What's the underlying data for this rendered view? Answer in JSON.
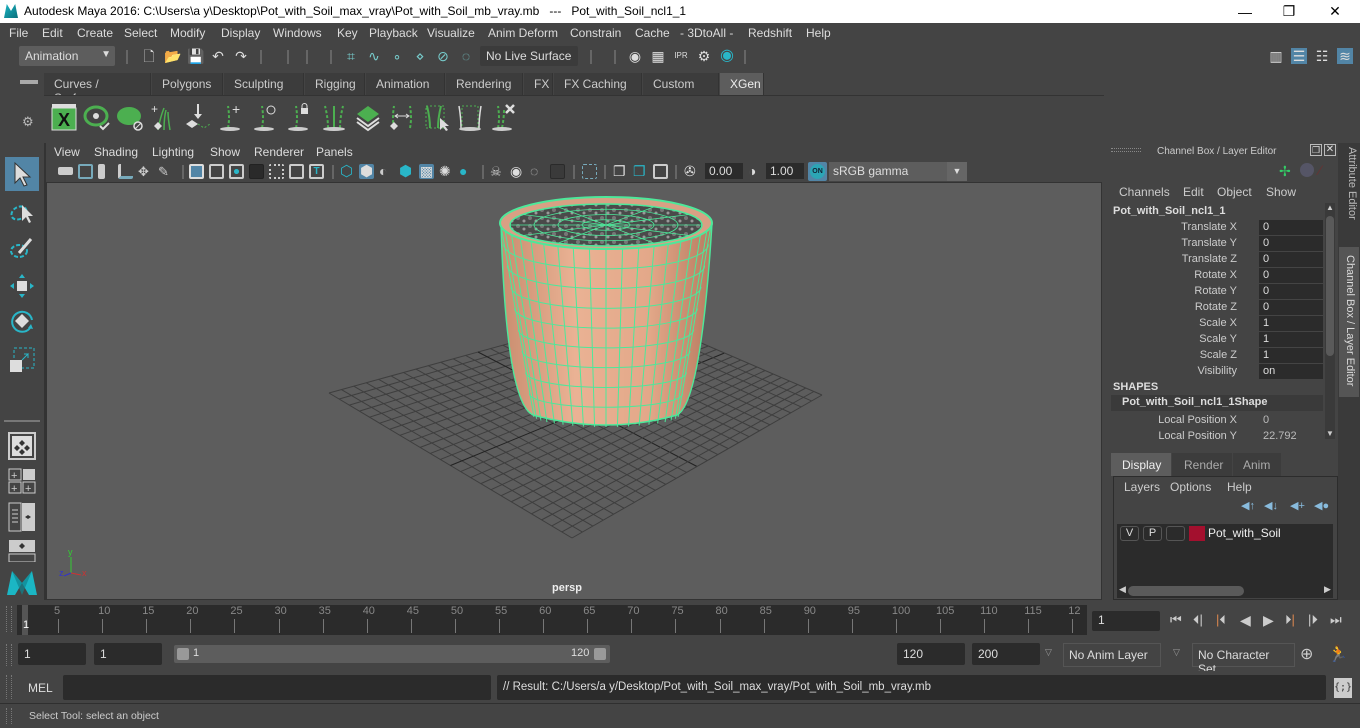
{
  "window": {
    "title": "Autodesk Maya 2016: C:\\Users\\a y\\Desktop\\Pot_with_Soil_max_vray\\Pot_with_Soil_mb_vray.mb   ---   Pot_with_Soil_ncl1_1",
    "minimize": "—",
    "maximize": "❐",
    "close": "✕"
  },
  "menubar": [
    "File",
    "Edit",
    "Create",
    "Select",
    "Modify",
    "Display",
    "Windows",
    "Key",
    "Playback",
    "Visualize",
    "Anim Deform",
    "Constrain",
    "Cache",
    "- 3DtoAll -",
    "Redshift",
    "Help"
  ],
  "toolbar": {
    "mode": "Animation",
    "live_surface": "No Live Surface"
  },
  "shelf": {
    "tabs": [
      "Curves / Surfaces",
      "Polygons",
      "Sculpting",
      "Rigging",
      "Animation",
      "Rendering",
      "FX",
      "FX Caching",
      "Custom",
      "XGen"
    ],
    "active_tab": "XGen",
    "icons": [
      "xgen-window-icon",
      "xgen-preview-icon",
      "xgen-clear-preview-icon",
      "xgen-add-guides-icon",
      "xgen-place-guides-icon",
      "xgen-add-guide-icon",
      "xgen-sculpt-guide-icon",
      "xgen-lock-guide-icon",
      "xgen-split-guide-icon",
      "xgen-tile-icon",
      "xgen-flip-guide-icon",
      "xgen-select-guide-icon",
      "xgen-guide-frame-icon",
      "xgen-delete-guide-icon"
    ]
  },
  "viewport": {
    "menu": [
      "View",
      "Shading",
      "Lighting",
      "Show",
      "Renderer",
      "Panels"
    ],
    "exposure": "0.00",
    "gamma": "1.00",
    "color_mgmt_toggle": "ON",
    "color_space": "sRGB gamma",
    "camera_label": "persp",
    "axis": {
      "x": "x",
      "y": "y",
      "z": "z"
    }
  },
  "channel_box": {
    "title": "Channel Box / Layer Editor",
    "menu": [
      "Channels",
      "Edit",
      "Object",
      "Show"
    ],
    "object_name": "Pot_with_Soil_ncl1_1",
    "attributes": [
      {
        "label": "Translate X",
        "value": "0"
      },
      {
        "label": "Translate Y",
        "value": "0"
      },
      {
        "label": "Translate Z",
        "value": "0"
      },
      {
        "label": "Rotate X",
        "value": "0"
      },
      {
        "label": "Rotate Y",
        "value": "0"
      },
      {
        "label": "Rotate Z",
        "value": "0"
      },
      {
        "label": "Scale X",
        "value": "1"
      },
      {
        "label": "Scale Y",
        "value": "1"
      },
      {
        "label": "Scale Z",
        "value": "1"
      },
      {
        "label": "Visibility",
        "value": "on"
      }
    ],
    "shapes_header": "SHAPES",
    "shape_name": "Pot_with_Soil_ncl1_1Shape",
    "shape_attributes": [
      {
        "label": "Local Position X",
        "value": "0"
      },
      {
        "label": "Local Position Y",
        "value": "22.792"
      }
    ]
  },
  "side_tabs": [
    "Attribute Editor",
    "Channel Box / Layer Editor"
  ],
  "layer_editor": {
    "tabs": [
      "Display",
      "Render",
      "Anim"
    ],
    "active_tab": "Display",
    "menu": [
      "Layers",
      "Options",
      "Help"
    ],
    "layers": [
      {
        "v": "V",
        "p": "P",
        "name": "Pot_with_Soil",
        "color": "#a3102e"
      }
    ]
  },
  "timeline": {
    "ticks": [
      "5",
      "10",
      "15",
      "20",
      "25",
      "30",
      "35",
      "40",
      "45",
      "50",
      "55",
      "60",
      "65",
      "70",
      "75",
      "80",
      "85",
      "90",
      "95",
      "100",
      "105",
      "110",
      "115",
      "12"
    ],
    "current_frame_marker": "1",
    "current_frame": "1"
  },
  "range": {
    "start": "1",
    "playback_start": "1",
    "slider_start": "1",
    "slider_end": "120",
    "playback_end": "120",
    "end": "200",
    "anim_layer": "No Anim Layer",
    "character_set": "No Character Set"
  },
  "mel": {
    "label": "MEL",
    "input": "",
    "result": "// Result: C:/Users/a y/Desktop/Pot_with_Soil_max_vray/Pot_with_Soil_mb_vray.mb"
  },
  "status": {
    "help_line": "Select Tool: select an object"
  },
  "colors": {
    "accent": "#5285a6",
    "wireframe": "#4de89a",
    "pot": "#e0a585",
    "layer_color": "#a3102e",
    "key_marker": "#d9864f"
  }
}
